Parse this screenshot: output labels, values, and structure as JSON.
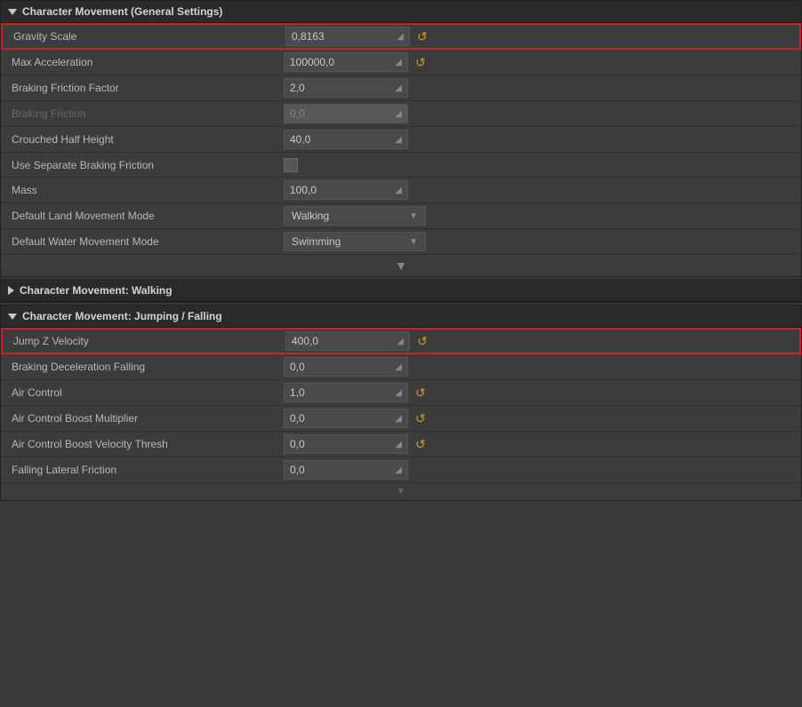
{
  "generalSettings": {
    "title": "Character Movement (General Settings)",
    "properties": [
      {
        "id": "gravity-scale",
        "label": "Gravity Scale",
        "value": "0,8163",
        "disabled": false,
        "showReset": true,
        "highlighted": true
      },
      {
        "id": "max-acceleration",
        "label": "Max Acceleration",
        "value": "100000,0",
        "disabled": false,
        "showReset": true,
        "highlighted": false
      },
      {
        "id": "braking-friction-factor",
        "label": "Braking Friction Factor",
        "value": "2,0",
        "disabled": false,
        "showReset": false,
        "highlighted": false
      },
      {
        "id": "braking-friction",
        "label": "Braking Friction",
        "value": "0,0",
        "disabled": true,
        "showReset": false,
        "highlighted": false
      },
      {
        "id": "crouched-half-height",
        "label": "Crouched Half Height",
        "value": "40,0",
        "disabled": false,
        "showReset": false,
        "highlighted": false
      },
      {
        "id": "use-separate-braking-friction",
        "label": "Use Separate Braking Friction",
        "value": null,
        "type": "checkbox",
        "disabled": false,
        "showReset": false,
        "highlighted": false
      },
      {
        "id": "mass",
        "label": "Mass",
        "value": "100,0",
        "disabled": false,
        "showReset": false,
        "highlighted": false
      },
      {
        "id": "default-land-movement-mode",
        "label": "Default Land Movement Mode",
        "value": "Walking",
        "type": "dropdown",
        "disabled": false,
        "showReset": false,
        "highlighted": false
      },
      {
        "id": "default-water-movement-mode",
        "label": "Default Water Movement Mode",
        "value": "Swimming",
        "type": "dropdown",
        "disabled": false,
        "showReset": false,
        "highlighted": false
      }
    ]
  },
  "walkingSection": {
    "title": "Character Movement: Walking",
    "collapsed": true
  },
  "jumpingFallingSection": {
    "title": "Character Movement: Jumping / Falling",
    "properties": [
      {
        "id": "jump-z-velocity",
        "label": "Jump Z Velocity",
        "value": "400,0",
        "disabled": false,
        "showReset": true,
        "highlighted": true
      },
      {
        "id": "braking-deceleration-falling",
        "label": "Braking Deceleration Falling",
        "value": "0,0",
        "disabled": false,
        "showReset": false,
        "highlighted": false
      },
      {
        "id": "air-control",
        "label": "Air Control",
        "value": "1,0",
        "disabled": false,
        "showReset": true,
        "highlighted": false
      },
      {
        "id": "air-control-boost-multiplier",
        "label": "Air Control Boost Multiplier",
        "value": "0,0",
        "disabled": false,
        "showReset": true,
        "highlighted": false
      },
      {
        "id": "air-control-boost-velocity-thresh",
        "label": "Air Control Boost Velocity Thresh",
        "value": "0,0",
        "disabled": false,
        "showReset": true,
        "highlighted": false
      },
      {
        "id": "falling-lateral-friction",
        "label": "Falling Lateral Friction",
        "value": "0,0",
        "disabled": false,
        "showReset": false,
        "highlighted": false
      }
    ]
  },
  "icons": {
    "reset": "↺",
    "inputArrow": "◢",
    "dropdownArrow": "▼",
    "triangleDown": "▼",
    "triangleRight": "▶"
  }
}
